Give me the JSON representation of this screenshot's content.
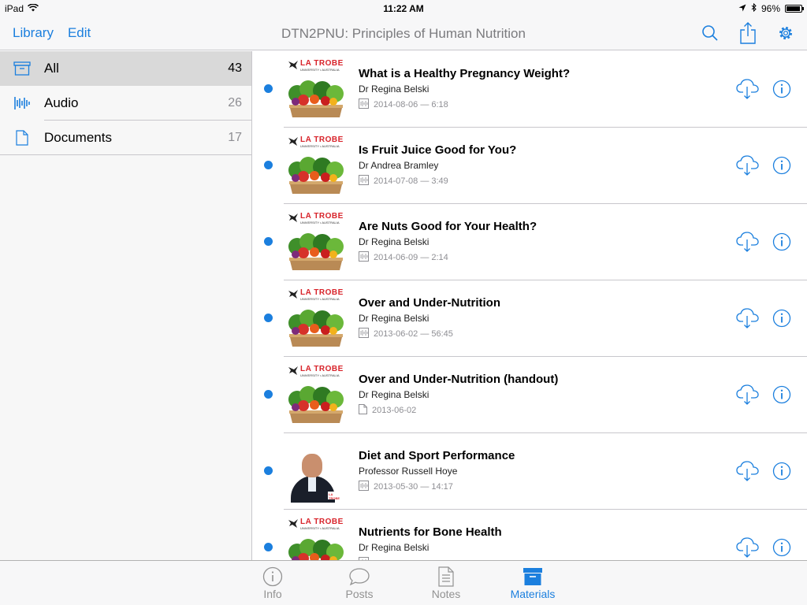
{
  "status": {
    "device": "iPad",
    "time": "11:22 AM",
    "battery": "96%",
    "battery_level": 0.96
  },
  "nav": {
    "library": "Library",
    "edit": "Edit",
    "title": "DTN2PNU: Principles of Human Nutrition"
  },
  "sidebar": {
    "items": [
      {
        "label": "All",
        "count": "43",
        "icon": "archive-box-icon"
      },
      {
        "label": "Audio",
        "count": "26",
        "icon": "audio-waveform-icon"
      },
      {
        "label": "Documents",
        "count": "17",
        "icon": "document-icon"
      }
    ]
  },
  "logo": {
    "name": "LA TROBE",
    "sub": "UNIVERSITY • AUSTRALIA"
  },
  "photo_thumb": {
    "caption_lines": [
      "Sport",
      "Unpacked",
      "with",
      "Russ Hoye"
    ],
    "badge": "LA TROBE"
  },
  "items": [
    {
      "title": "What is a Healthy Pregnancy Weight?",
      "author": "Dr Regina Belski",
      "meta": "2014-08-06 — 6:18",
      "type": "audio"
    },
    {
      "title": "Is Fruit Juice Good for You?",
      "author": "Dr Andrea Bramley",
      "meta": "2014-07-08 — 3:49",
      "type": "audio"
    },
    {
      "title": "Are Nuts Good for Your Health?",
      "author": "Dr Regina Belski",
      "meta": "2014-06-09 — 2:14",
      "type": "audio"
    },
    {
      "title": "Over and Under-Nutrition",
      "author": "Dr Regina Belski",
      "meta": "2013-06-02 — 56:45",
      "type": "audio"
    },
    {
      "title": "Over and Under-Nutrition (handout)",
      "author": "Dr Regina Belski",
      "meta": "2013-06-02",
      "type": "document"
    },
    {
      "title": "Diet and Sport Performance",
      "author": "Professor Russell Hoye",
      "meta": "2013-05-30 — 14:17",
      "type": "audio"
    },
    {
      "title": "Nutrients for Bone Health",
      "author": "Dr Regina Belski",
      "meta": "",
      "type": "audio"
    }
  ],
  "tabs": [
    {
      "label": "Info",
      "icon": "info-icon"
    },
    {
      "label": "Posts",
      "icon": "speech-bubble-icon"
    },
    {
      "label": "Notes",
      "icon": "note-icon"
    },
    {
      "label": "Materials",
      "icon": "archive-box-icon"
    }
  ],
  "colors": {
    "accent": "#1b7fde",
    "brand_red": "#d8232a"
  }
}
